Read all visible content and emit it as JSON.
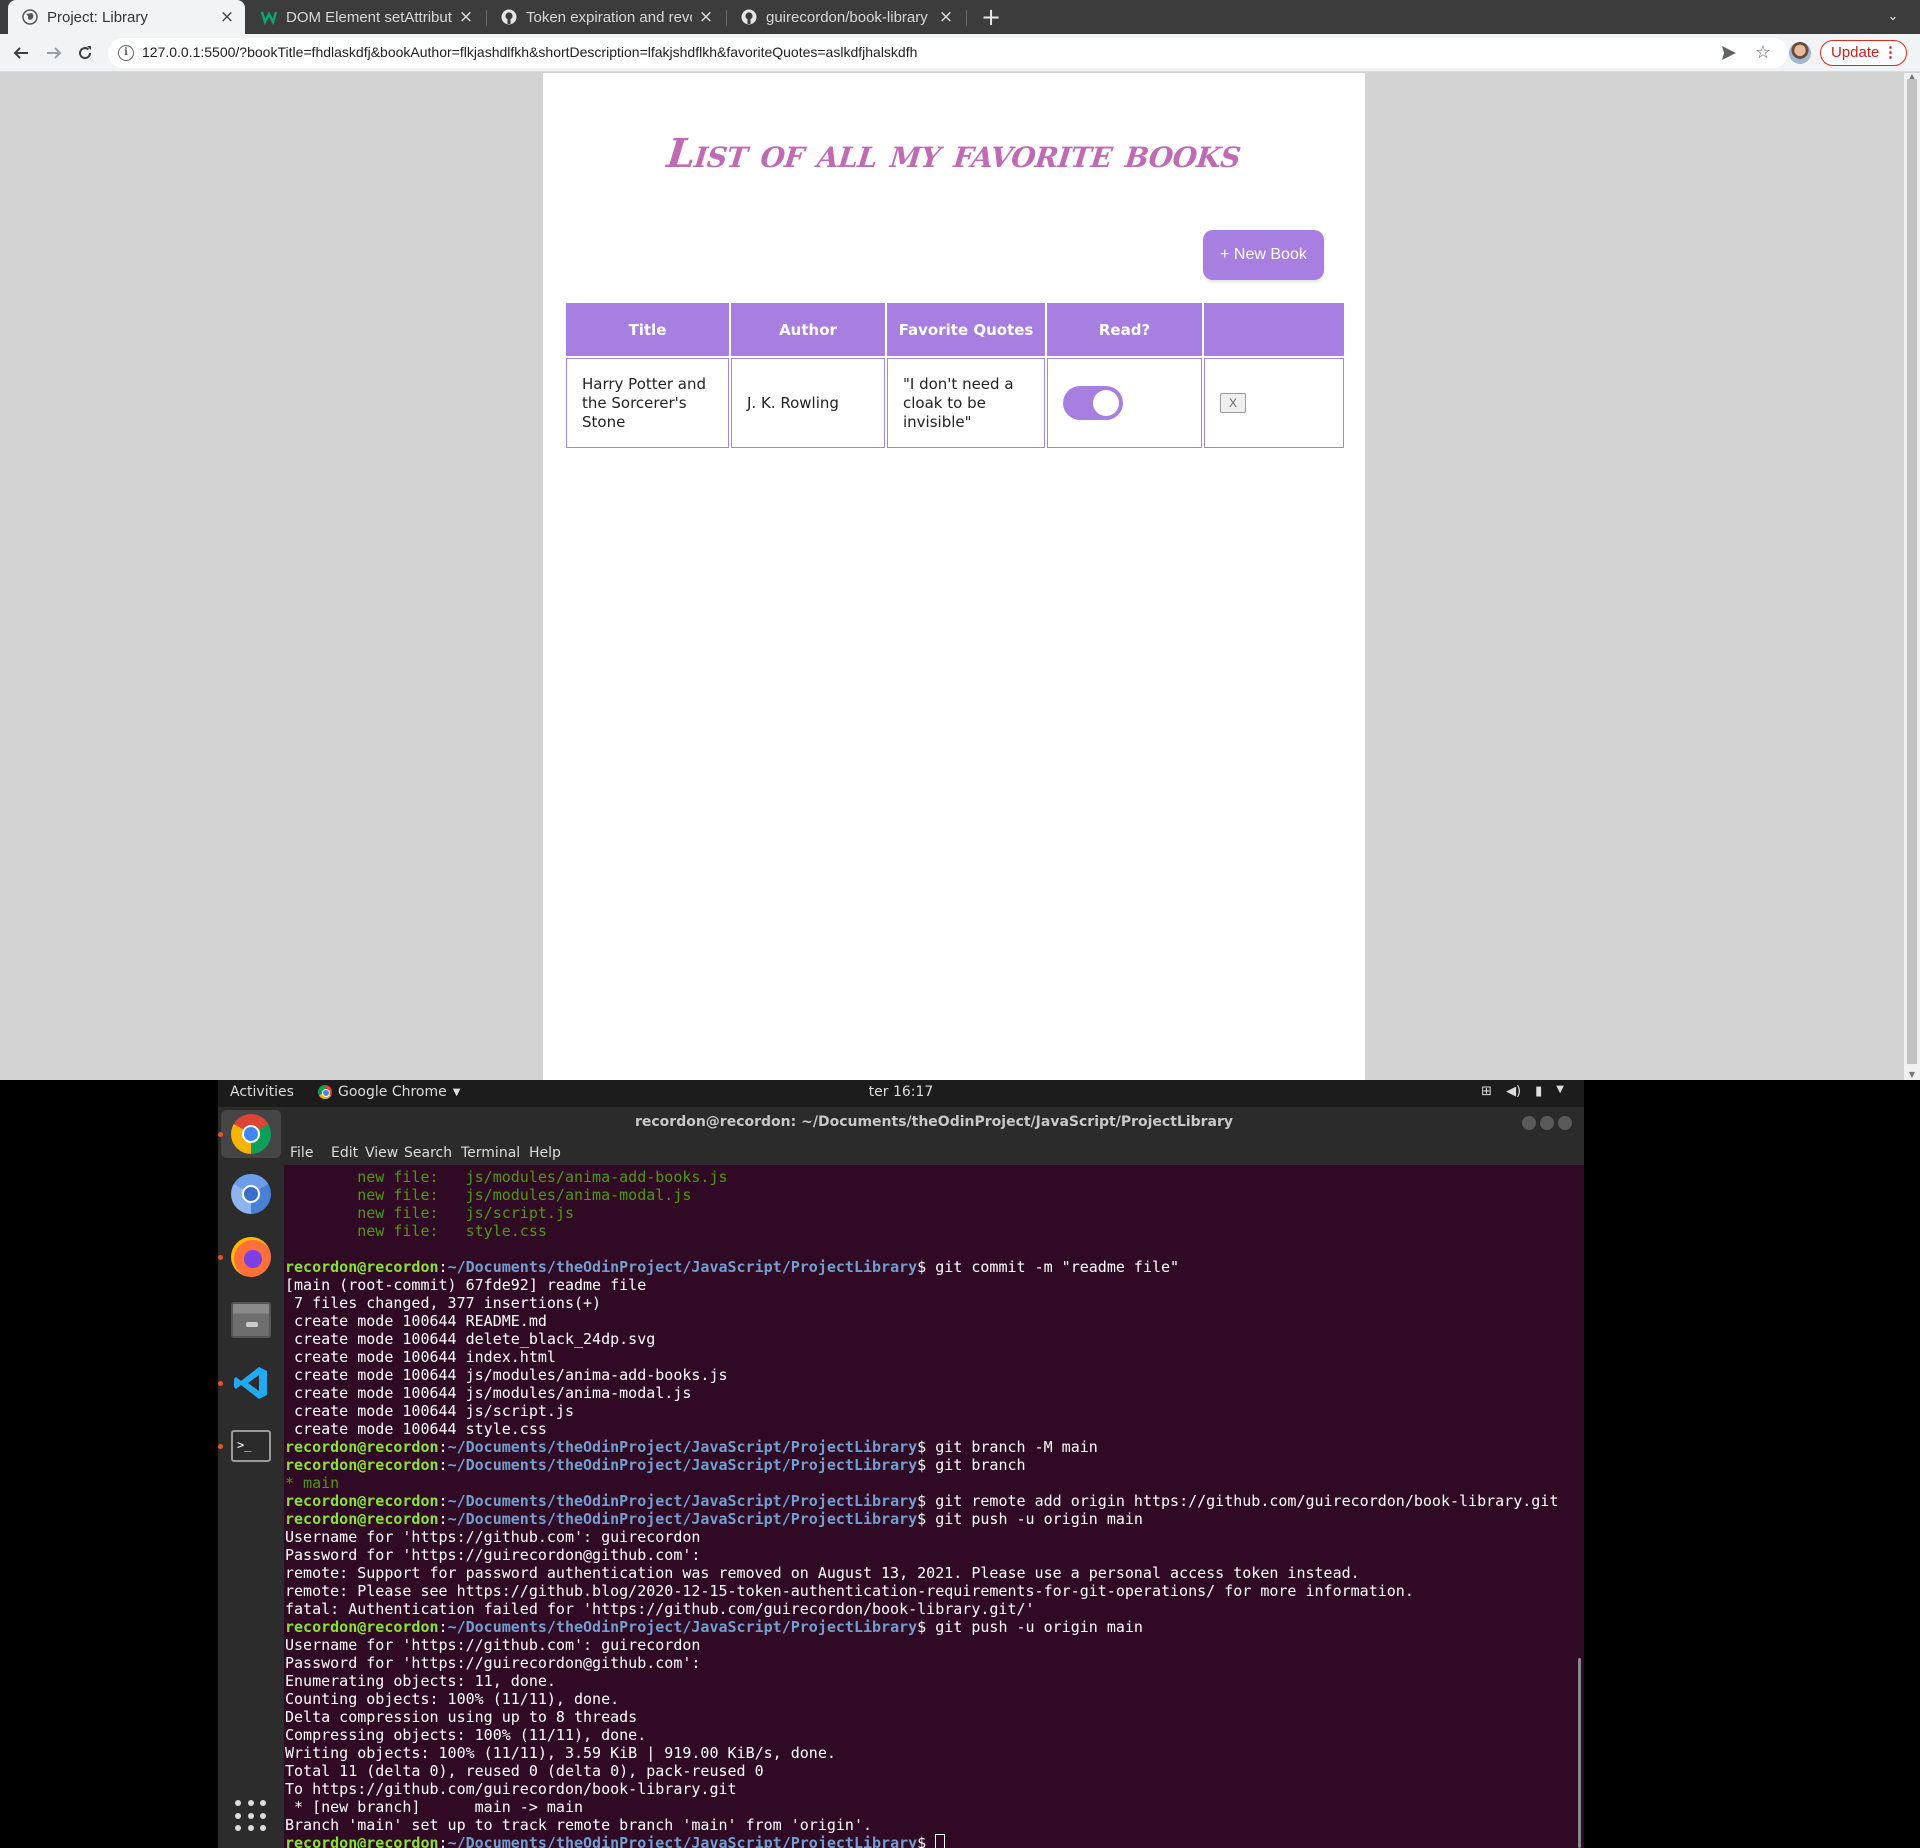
{
  "browser": {
    "tabs": [
      {
        "title": "Project: Library",
        "favicon": "globe-icon",
        "active": true
      },
      {
        "title": "DOM Element setAttribute",
        "favicon": "w3schools-icon",
        "active": false
      },
      {
        "title": "Token expiration and revo",
        "favicon": "github-icon",
        "active": false
      },
      {
        "title": "guirecordon/book-library",
        "favicon": "github-icon",
        "active": false
      }
    ],
    "new_tab_label": "+",
    "url": "127.0.0.1:5500/?bookTitle=fhdlaskdfj&bookAuthor=flkjashdlfkh&shortDescription=lfakjshdflkh&favoriteQuotes=aslkdfjhalskdfh",
    "update_label": "Update",
    "accent_color": "#d93025"
  },
  "page": {
    "title": "List of all my favorite books",
    "new_book_label": "+ New Book",
    "accent_color": "#a77fe0",
    "title_color": "#c06ab6",
    "table": {
      "headers": [
        "Title",
        "Author",
        "Favorite Quotes",
        "Read?",
        ""
      ],
      "rows": [
        {
          "title": "Harry Potter and the Sorcerer's Stone",
          "author": "J. K. Rowling",
          "quote": "\"I don't need a cloak to be invisible\"",
          "read": true,
          "delete_label": "X"
        }
      ]
    }
  },
  "desktop": {
    "activities_label": "Activities",
    "app_label": "Google Chrome",
    "clock": "ter 16:17",
    "dock_apps": [
      "google-chrome-icon",
      "chromium-icon",
      "firefox-icon",
      "files-icon",
      "vscode-icon",
      "terminal-icon"
    ]
  },
  "terminal": {
    "title": "recordon@recordon: ~/Documents/theOdinProject/JavaScript/ProjectLibrary",
    "menu": [
      "File",
      "Edit",
      "View",
      "Search",
      "Terminal",
      "Help"
    ],
    "background_color": "#300a24",
    "prompt_user": "recordon@recordon",
    "prompt_path": "~/Documents/theOdinProject/JavaScript/ProjectLibrary",
    "lines": [
      {
        "type": "status",
        "text": "        new file:   js/modules/anima-add-books.js"
      },
      {
        "type": "status",
        "text": "        new file:   js/modules/anima-modal.js"
      },
      {
        "type": "status",
        "text": "        new file:   js/script.js"
      },
      {
        "type": "status",
        "text": "        new file:   style.css"
      },
      {
        "type": "plain",
        "text": ""
      },
      {
        "type": "prompt",
        "text": "git commit -m \"readme file\""
      },
      {
        "type": "plain",
        "text": "[main (root-commit) 67fde92] readme file"
      },
      {
        "type": "plain",
        "text": " 7 files changed, 377 insertions(+)"
      },
      {
        "type": "plain",
        "text": " create mode 100644 README.md"
      },
      {
        "type": "plain",
        "text": " create mode 100644 delete_black_24dp.svg"
      },
      {
        "type": "plain",
        "text": " create mode 100644 index.html"
      },
      {
        "type": "plain",
        "text": " create mode 100644 js/modules/anima-add-books.js"
      },
      {
        "type": "plain",
        "text": " create mode 100644 js/modules/anima-modal.js"
      },
      {
        "type": "plain",
        "text": " create mode 100644 js/script.js"
      },
      {
        "type": "plain",
        "text": " create mode 100644 style.css"
      },
      {
        "type": "prompt",
        "text": "git branch -M main"
      },
      {
        "type": "prompt",
        "text": "git branch"
      },
      {
        "type": "status",
        "text": "* main"
      },
      {
        "type": "prompt",
        "text": "git remote add origin https://github.com/guirecordon/book-library.git"
      },
      {
        "type": "prompt",
        "text": "git push -u origin main"
      },
      {
        "type": "plain",
        "text": "Username for 'https://github.com': guirecordon"
      },
      {
        "type": "plain",
        "text": "Password for 'https://guirecordon@github.com':"
      },
      {
        "type": "plain",
        "text": "remote: Support for password authentication was removed on August 13, 2021. Please use a personal access token instead."
      },
      {
        "type": "plain",
        "text": "remote: Please see https://github.blog/2020-12-15-token-authentication-requirements-for-git-operations/ for more information."
      },
      {
        "type": "plain",
        "text": "fatal: Authentication failed for 'https://github.com/guirecordon/book-library.git/'"
      },
      {
        "type": "prompt",
        "text": "git push -u origin main"
      },
      {
        "type": "plain",
        "text": "Username for 'https://github.com': guirecordon"
      },
      {
        "type": "plain",
        "text": "Password for 'https://guirecordon@github.com':"
      },
      {
        "type": "plain",
        "text": "Enumerating objects: 11, done."
      },
      {
        "type": "plain",
        "text": "Counting objects: 100% (11/11), done."
      },
      {
        "type": "plain",
        "text": "Delta compression using up to 8 threads"
      },
      {
        "type": "plain",
        "text": "Compressing objects: 100% (11/11), done."
      },
      {
        "type": "plain",
        "text": "Writing objects: 100% (11/11), 3.59 KiB | 919.00 KiB/s, done."
      },
      {
        "type": "plain",
        "text": "Total 11 (delta 0), reused 0 (delta 0), pack-reused 0"
      },
      {
        "type": "plain",
        "text": "To https://github.com/guirecordon/book-library.git"
      },
      {
        "type": "plain",
        "text": " * [new branch]      main -> main"
      },
      {
        "type": "plain",
        "text": "Branch 'main' set up to track remote branch 'main' from 'origin'."
      },
      {
        "type": "prompt-cursor",
        "text": ""
      }
    ]
  }
}
